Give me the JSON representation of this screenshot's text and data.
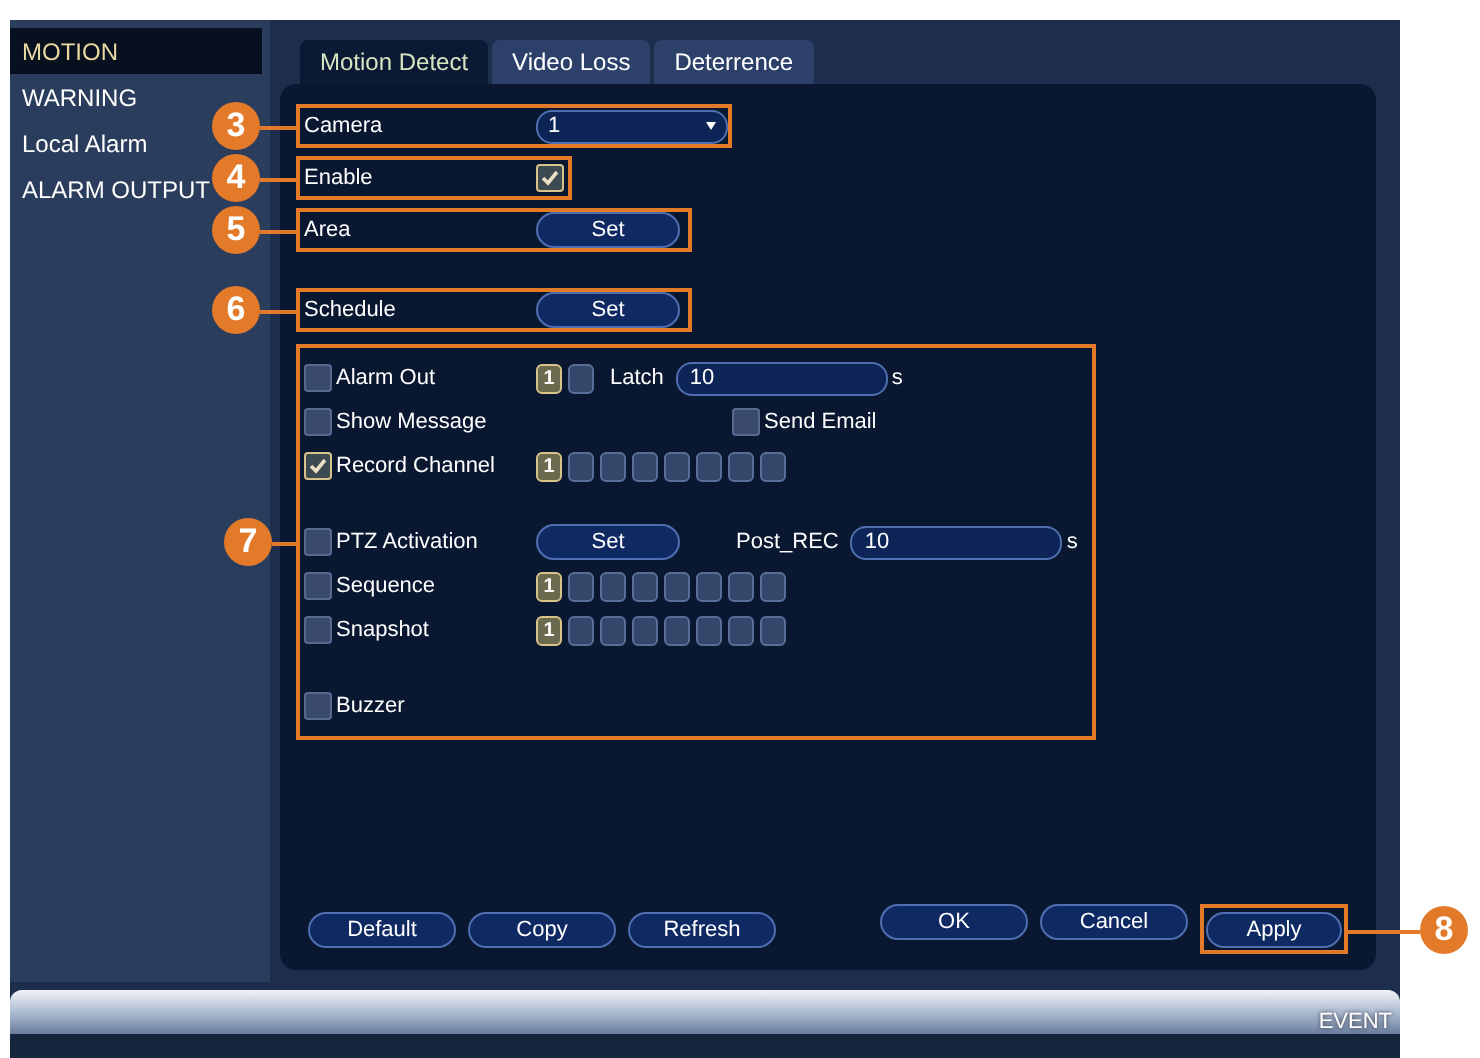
{
  "sidebar": {
    "items": [
      {
        "label": "MOTION",
        "selected": true
      },
      {
        "label": "WARNING",
        "selected": false
      },
      {
        "label": "Local Alarm",
        "selected": false
      },
      {
        "label": "ALARM OUTPUT",
        "selected": false
      }
    ]
  },
  "tabs": [
    {
      "label": "Motion Detect",
      "selected": true
    },
    {
      "label": "Video Loss",
      "selected": false
    },
    {
      "label": "Deterrence",
      "selected": false
    }
  ],
  "settings": [
    {
      "kind": "dropdown",
      "label": "Camera",
      "value": "1",
      "callout": "3"
    },
    {
      "kind": "checkbox",
      "label": "Enable",
      "checked": true,
      "callout": "4"
    },
    {
      "kind": "button",
      "label": "Area",
      "button": "Set",
      "callout": "5"
    },
    {
      "kind": "button",
      "label": "Schedule",
      "button": "Set",
      "callout": "6"
    }
  ],
  "actions": {
    "callout": "7",
    "rows": [
      {
        "options": [
          {
            "label": "Alarm Out",
            "checked": false
          }
        ],
        "channels": [
          {
            "label": "1",
            "checked": true
          },
          {
            "checked": false
          }
        ],
        "field": {
          "label": "Latch",
          "value": "10",
          "unit": "s"
        }
      },
      {
        "options": [
          {
            "label": "Show Message",
            "checked": false
          },
          {
            "label": "Send Email",
            "checked": false
          }
        ]
      },
      {
        "options": [
          {
            "label": "Record Channel",
            "checked": true
          }
        ],
        "channels": [
          {
            "label": "1",
            "checked": true
          },
          {
            "checked": false
          },
          {
            "checked": false
          },
          {
            "checked": false
          },
          {
            "checked": false
          },
          {
            "checked": false
          },
          {
            "checked": false
          },
          {
            "checked": false
          }
        ]
      },
      {
        "options": [
          {
            "label": "PTZ Activation",
            "checked": false
          }
        ],
        "button": "Set",
        "field": {
          "label": "Post_REC",
          "value": "10",
          "unit": "s"
        }
      },
      {
        "options": [
          {
            "label": "Sequence",
            "checked": false
          }
        ],
        "channels": [
          {
            "label": "1",
            "checked": true
          },
          {
            "checked": false
          },
          {
            "checked": false
          },
          {
            "checked": false
          },
          {
            "checked": false
          },
          {
            "checked": false
          },
          {
            "checked": false
          },
          {
            "checked": false
          }
        ]
      },
      {
        "options": [
          {
            "label": "Snapshot",
            "checked": false
          }
        ],
        "channels": [
          {
            "label": "1",
            "checked": true
          },
          {
            "checked": false
          },
          {
            "checked": false
          },
          {
            "checked": false
          },
          {
            "checked": false
          },
          {
            "checked": false
          },
          {
            "checked": false
          },
          {
            "checked": false
          }
        ]
      },
      {
        "options": [
          {
            "label": "Buzzer",
            "checked": false
          }
        ]
      }
    ]
  },
  "footer": {
    "left": [
      {
        "label": "Default"
      },
      {
        "label": "Copy"
      },
      {
        "label": "Refresh"
      }
    ],
    "right": [
      {
        "label": "OK"
      },
      {
        "label": "Cancel"
      },
      {
        "label": "Apply",
        "callout": "8"
      }
    ]
  },
  "status_bar": {
    "label": "EVENT"
  }
}
